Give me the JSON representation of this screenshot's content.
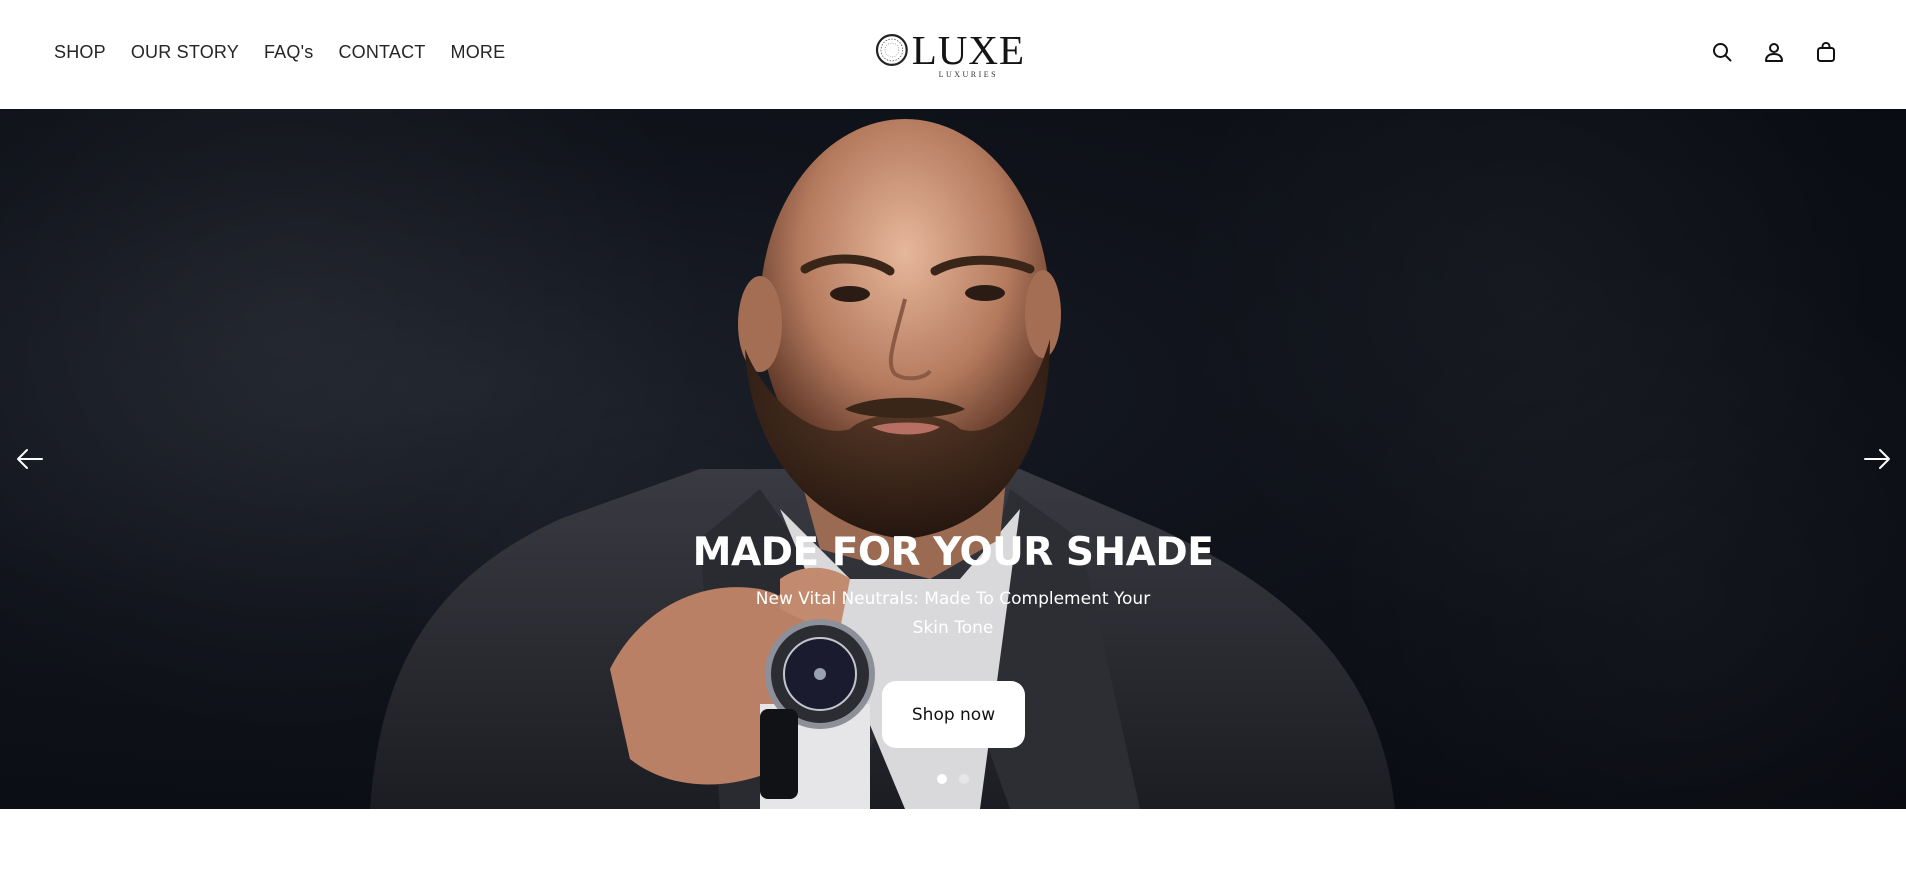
{
  "header": {
    "nav": [
      {
        "label": "SHOP"
      },
      {
        "label": "OUR STORY"
      },
      {
        "label": "FAQ's"
      },
      {
        "label": "CONTACT"
      },
      {
        "label": "MORE"
      }
    ],
    "logo": {
      "brand": "LUXE",
      "tagline": "LUXURIES"
    },
    "icons": [
      "search-icon",
      "account-icon",
      "cart-icon"
    ]
  },
  "hero": {
    "title": "MADE FOR YOUR SHADE",
    "subtitle": "New Vital Neutrals: Made To Complement Your Skin Tone",
    "cta_label": "Shop now",
    "slides_total": 2,
    "active_slide": 1,
    "arrows": [
      "arrow-left-icon",
      "arrow-right-icon"
    ]
  },
  "colors": {
    "header_bg": "#ffffff",
    "hero_bg": "#0d1017",
    "cta_bg": "#ffffff",
    "text_dark": "#1a1a1a",
    "text_light": "#ffffff"
  }
}
